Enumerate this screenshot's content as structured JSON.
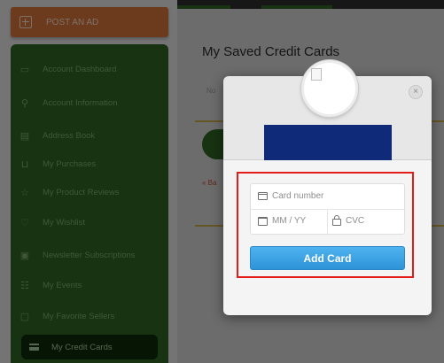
{
  "sidebar": {
    "post_ad_label": "POST AN AD",
    "items": [
      {
        "label": "Account Dashboard",
        "icon": "monitor-icon"
      },
      {
        "label": "Account Information",
        "icon": "user-icon"
      },
      {
        "label": "Address Book",
        "icon": "address-book-icon"
      },
      {
        "label": "My Purchases",
        "icon": "cart-icon"
      },
      {
        "label": "My Product Reviews",
        "icon": "star-icon"
      },
      {
        "label": "My Wishlist",
        "icon": "heart-icon"
      },
      {
        "label": "Newsletter Subscriptions",
        "icon": "newsletter-icon"
      },
      {
        "label": "My Events",
        "icon": "events-icon"
      },
      {
        "label": "My Favorite Sellers",
        "icon": "favorite-sellers-icon"
      },
      {
        "label": "My Credit Cards",
        "icon": "credit-card-icon",
        "active": true
      }
    ]
  },
  "main": {
    "title": "My Saved Credit Cards",
    "note": "No",
    "link": "« Ba"
  },
  "modal": {
    "close_symbol": "×",
    "card_number_placeholder": "Card number",
    "expiry_placeholder": "MM / YY",
    "cvc_placeholder": "CVC",
    "submit_label": "Add Card"
  },
  "colors": {
    "sidebar_green": "#2e6624",
    "active_item": "#0d2a08",
    "post_ad_orange": "#d8753a",
    "add_card_blue": "#3a9fe0",
    "highlight_red": "#e21b1b",
    "brand_box": "#0f2a78"
  }
}
